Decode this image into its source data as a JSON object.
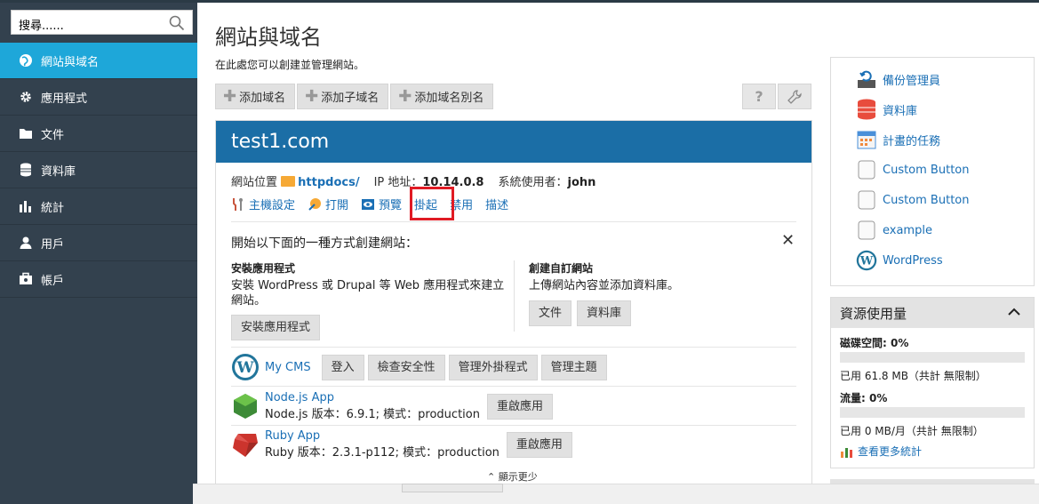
{
  "search": {
    "placeholder": "搜尋......"
  },
  "sidebar": {
    "items": [
      {
        "label": "網站與域名",
        "icon": "globe-icon"
      },
      {
        "label": "應用程式",
        "icon": "gear-icon"
      },
      {
        "label": "文件",
        "icon": "folder-icon"
      },
      {
        "label": "資料庫",
        "icon": "database-icon"
      },
      {
        "label": "統計",
        "icon": "chart-icon"
      },
      {
        "label": "用戶",
        "icon": "user-icon"
      },
      {
        "label": "帳戶",
        "icon": "account-icon"
      }
    ]
  },
  "page": {
    "title": "網站與域名",
    "description": "在此處您可以創建並管理網站。"
  },
  "toolbar": {
    "add_domain": "添加域名",
    "add_subdomain": "添加子域名",
    "add_alias": "添加域名別名"
  },
  "domain": {
    "name": "test1.com",
    "location_label": "網站位置",
    "location_value": "httpdocs/",
    "ip_label": "IP 地址：",
    "ip_value": "10.14.0.8",
    "sysuser_label": "系統使用者：",
    "sysuser_value": "john",
    "actions": {
      "hosting": "主機設定",
      "open": "打開",
      "preview": "預覽",
      "suspend": "掛起",
      "disable": "禁用",
      "describe": "描述"
    }
  },
  "start": {
    "title": "開始以下面的一種方式創建網站：",
    "install_title": "安裝應用程式",
    "install_desc": "安裝 WordPress 或 Drupal 等 Web 應用程式來建立網站。",
    "install_button": "安裝應用程式",
    "custom_title": "創建自訂網站",
    "custom_desc": "上傳網站內容並添加資料庫。",
    "files_button": "文件",
    "db_button": "資料庫"
  },
  "apps": {
    "mycms": {
      "name": "My CMS",
      "login": "登入",
      "security": "檢查安全性",
      "plugins": "管理外掛程式",
      "themes": "管理主題"
    },
    "node": {
      "name": "Node.js App",
      "info": "Node.js 版本：6.9.1; 模式：production",
      "restart": "重啟應用"
    },
    "ruby": {
      "name": "Ruby App",
      "info": "Ruby 版本：2.3.1-p112; 模式：production",
      "restart": "重啟應用"
    }
  },
  "show_less": "顯示更少",
  "right": {
    "items": [
      {
        "label": "備份管理員",
        "icon": "backup-icon"
      },
      {
        "label": "資料庫",
        "icon": "database-icon"
      },
      {
        "label": "計畫的任務",
        "icon": "calendar-icon"
      },
      {
        "label": "Custom Button",
        "icon": "custom-button-icon"
      },
      {
        "label": "Custom Button",
        "icon": "custom-button-icon"
      },
      {
        "label": "example",
        "icon": "custom-button-icon"
      },
      {
        "label": "WordPress",
        "icon": "wordpress-icon"
      }
    ]
  },
  "resources": {
    "title": "資源使用量",
    "disk_label": "磁碟空間: 0%",
    "disk_used": "已用 61.8 MB（共計 無限制）",
    "traffic_label": "流量: 0%",
    "traffic_used": "已用 0 MB/月（共計 無限制）",
    "more_stats": "查看更多統計",
    "disk_percent": 0,
    "traffic_percent": 0
  },
  "colors": {
    "sidebar_bg": "#33414e",
    "active": "#1ea7d9",
    "domain_header": "#1b6ea6",
    "link": "#1a6fb5",
    "highlight": "#e01b24"
  }
}
